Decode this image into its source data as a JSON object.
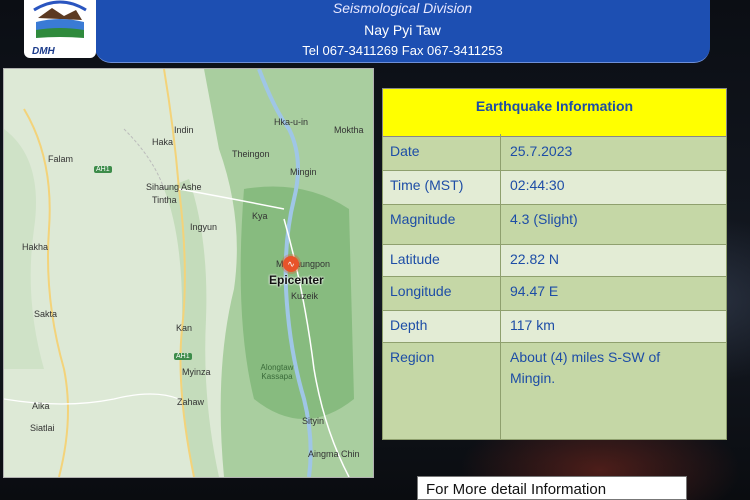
{
  "header": {
    "division": "Seismological Division",
    "city": "Nay Pyi Taw",
    "contact": "Tel 067-3411269 Fax 067-3411253",
    "logo_text": "DMH"
  },
  "map": {
    "labels": {
      "falam": "Falam",
      "haka": "Haka",
      "indin": "Indin",
      "theingon": "Theingon",
      "hka_u_in": "Hka-u-in",
      "moktha": "Moktha",
      "mingin": "Mingin",
      "sihaung_ashe": "Sihaung Ashe",
      "tintha": "Tintha",
      "ingyun": "Ingyun",
      "hakha": "Hakha",
      "kyawzu": "Kya",
      "migyaungpon": "Migyaungpon",
      "kuzeik": "Kuzeik",
      "sakta": "Sakta",
      "kan": "Kan",
      "alongtaw_kassapa": "Alongtaw Kassapa",
      "myinza": "Myinza",
      "zahaw": "Zahaw",
      "aika": "Aika",
      "siatlai": "Siatlai",
      "sityin": "Sityin",
      "aingma_chin": "Aingma Chin",
      "ah1_a": "AH1",
      "ah1_b": "AH1"
    },
    "epicenter_label": "Epicenter"
  },
  "info": {
    "title": "Earthquake Information",
    "rows": [
      {
        "key": "Date",
        "value": "25.7.2023"
      },
      {
        "key": "Time (MST)",
        "value": "02:44:30"
      },
      {
        "key": "Magnitude",
        "value": "4.3 (Slight)"
      },
      {
        "key": "Latitude",
        "value": "22.82 N"
      },
      {
        "key": "Longitude",
        "value": "94.47 E"
      },
      {
        "key": "Depth",
        "value": "117 km"
      },
      {
        "key": "Region",
        "value": "About (4) miles S-SW of Mingin."
      }
    ]
  },
  "footer": {
    "text": "For More detail Information"
  },
  "colors": {
    "header_bg": "#1d4fb2",
    "title_bg": "#ffff00",
    "row_dark": "#c5d7a6",
    "row_light": "#e3ecd5",
    "text_blue": "#1d4da6",
    "epicenter": "#e8542a"
  }
}
